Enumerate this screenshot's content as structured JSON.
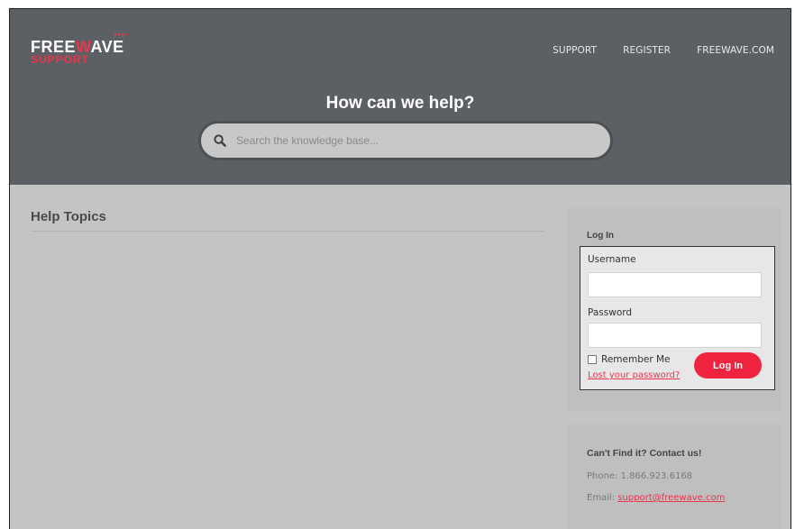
{
  "brand": {
    "logo_dots": "●●●●",
    "logo_main_prefix": "FREE",
    "logo_main_highlight": "W",
    "logo_main_suffix": "AVE",
    "logo_sub": "SUPPORT",
    "accent_color": "#e8364d",
    "header_bg": "#5c5f64"
  },
  "nav": {
    "items": [
      {
        "label": "SUPPORT"
      },
      {
        "label": "REGISTER"
      },
      {
        "label": "FREEWAVE.COM"
      }
    ]
  },
  "hero": {
    "title": "How can we help?",
    "search_placeholder": "Search the knowledge base..."
  },
  "main": {
    "section_title": "Help Topics"
  },
  "login": {
    "title": "Log In",
    "username_label": "Username",
    "username_value": "",
    "password_label": "Password",
    "password_value": "",
    "remember_label": "Remember Me",
    "remember_checked": false,
    "lost_password_label": "Lost your password?",
    "submit_label": "Log In"
  },
  "contact": {
    "title": "Can't Find it? Contact us!",
    "phone_label": "Phone: 1.866.923.6168",
    "email_prefix": "Email: ",
    "email": "support@freewave.com"
  }
}
